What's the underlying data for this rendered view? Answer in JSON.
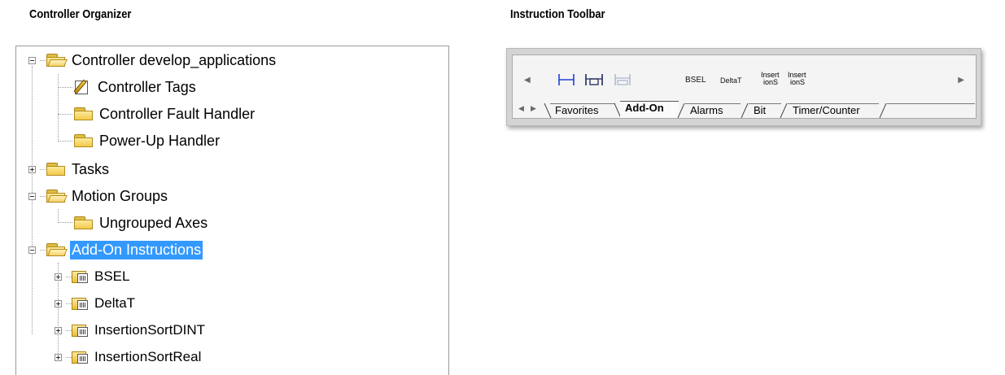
{
  "captions": {
    "organizer": "Controller Organizer",
    "toolbar": "Instruction Toolbar"
  },
  "organizer": {
    "items": [
      {
        "label": "Controller develop_applications",
        "icon": "folder-open-icon",
        "expander": "minus"
      },
      {
        "label": "Controller Tags",
        "icon": "controller-tags-icon"
      },
      {
        "label": "Controller Fault Handler",
        "icon": "folder-icon"
      },
      {
        "label": "Power-Up Handler",
        "icon": "folder-icon"
      },
      {
        "label": "Tasks",
        "icon": "folder-icon",
        "expander": "plus"
      },
      {
        "label": "Motion Groups",
        "icon": "folder-open-icon",
        "expander": "minus"
      },
      {
        "label": "Ungrouped Axes",
        "icon": "folder-icon"
      },
      {
        "label": "Add-On Instructions",
        "icon": "folder-open-icon",
        "expander": "minus",
        "selected": true
      },
      {
        "label": "BSEL",
        "icon": "add-on-instruction-icon",
        "expander": "plus"
      },
      {
        "label": "DeltaT",
        "icon": "add-on-instruction-icon",
        "expander": "plus"
      },
      {
        "label": "InsertionSortDINT",
        "icon": "add-on-instruction-icon",
        "expander": "plus"
      },
      {
        "label": "InsertionSortReal",
        "icon": "add-on-instruction-icon",
        "expander": "plus"
      }
    ],
    "selection_color": "#3399ff"
  },
  "toolbar": {
    "buttons": {
      "bsel": "BSEL",
      "deltat": "DeltaT",
      "insertion1_line1": "Insert",
      "insertion1_line2": "ionS",
      "insertion2_line1": "Insert",
      "insertion2_line2": "ionS"
    },
    "tabs": {
      "favorites": "Favorites",
      "addon": "Add-On",
      "alarms": "Alarms",
      "bit": "Bit",
      "timer": "Timer/Counter"
    },
    "active_tab": "Add-On"
  }
}
